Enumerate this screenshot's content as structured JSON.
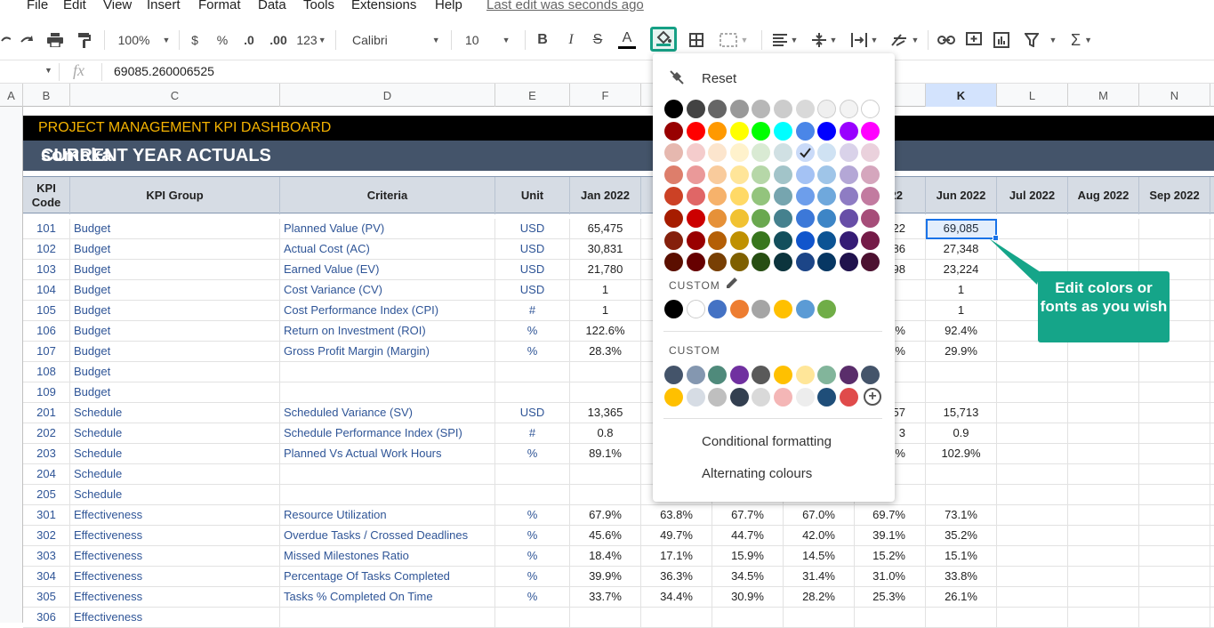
{
  "menu": {
    "items": [
      "File",
      "Edit",
      "View",
      "Insert",
      "Format",
      "Data",
      "Tools",
      "Extensions",
      "Help"
    ],
    "last_edit": "Last edit was seconds ago"
  },
  "toolbar": {
    "zoom": "100%",
    "currency": "$",
    "percent": "%",
    "dec_decrease": ".0",
    "dec_increase": ".00",
    "more_formats": "123",
    "font": "Calibri",
    "font_size": "10",
    "bold": "B",
    "italic": "I",
    "strike": "S",
    "text_color": "A",
    "sum": "Σ",
    "icons": [
      "undo-icon",
      "redo-icon",
      "print-icon",
      "paint-format-icon",
      "fill-color-icon",
      "borders-icon",
      "merge-icon",
      "align-icon",
      "valign-icon",
      "wrap-icon",
      "rotate-icon",
      "link-icon",
      "comment-icon",
      "chart-icon",
      "filter-icon",
      "functions-icon"
    ]
  },
  "formula_bar": {
    "fx": "fx",
    "value": "69085.260006525"
  },
  "columns": [
    "A",
    "B",
    "C",
    "D",
    "E",
    "F",
    "G",
    "H",
    "I",
    "J",
    "K",
    "L",
    "M",
    "N"
  ],
  "selected_column": "K",
  "sheet": {
    "title": "PROJECT MANAGEMENT KPI DASHBOARD",
    "subtitle": "CURRENT YEAR ACTUALS",
    "logo": "someka",
    "headers": {
      "code": "KPI Code",
      "group": "KPI Group",
      "criteria": "Criteria",
      "unit": "Unit",
      "months": [
        "Jan 2022",
        "",
        "",
        "",
        "2022",
        "Jun 2022",
        "Jul 2022",
        "Aug 2022",
        "Sep 2022"
      ]
    },
    "rows": [
      {
        "rn": "",
        "code": "101",
        "group": "Budget",
        "criteria": "Planned Value (PV)",
        "unit": "USD",
        "f": "65,475",
        "g": "",
        "h": "",
        "i": "",
        "j": "22",
        "k": "69,085"
      },
      {
        "rn": "",
        "code": "102",
        "group": "Budget",
        "criteria": "Actual Cost (AC)",
        "unit": "USD",
        "f": "30,831",
        "g": "",
        "h": "",
        "i": "",
        "j": "86",
        "k": "27,348"
      },
      {
        "rn": "",
        "code": "103",
        "group": "Budget",
        "criteria": "Earned Value (EV)",
        "unit": "USD",
        "f": "21,780",
        "g": "",
        "h": "",
        "i": "",
        "j": "98",
        "k": "23,224"
      },
      {
        "rn": "",
        "code": "104",
        "group": "Budget",
        "criteria": "Cost Variance (CV)",
        "unit": "USD",
        "f": "1",
        "g": "",
        "h": "",
        "i": "",
        "j": "",
        "k": "1"
      },
      {
        "rn": "",
        "code": "105",
        "group": "Budget",
        "criteria": "Cost Performance Index (CPI)",
        "unit": "#",
        "f": "1",
        "g": "",
        "h": "",
        "i": "",
        "j": "",
        "k": "1"
      },
      {
        "rn": "",
        "code": "106",
        "group": "Budget",
        "criteria": "Return on Investment (ROI)",
        "unit": "%",
        "f": "122.6%",
        "g": "",
        "h": "",
        "i": "",
        "j": "4%",
        "k": "92.4%"
      },
      {
        "rn": "",
        "code": "107",
        "group": "Budget",
        "criteria": "Gross Profit Margin (Margin)",
        "unit": "%",
        "f": "28.3%",
        "g": "",
        "h": "",
        "i": "",
        "j": "4%",
        "k": "29.9%"
      },
      {
        "rn": "",
        "code": "108",
        "group": "Budget",
        "criteria": "",
        "unit": "",
        "f": "",
        "g": "",
        "h": "",
        "i": "",
        "j": "",
        "k": ""
      },
      {
        "rn": "",
        "code": "109",
        "group": "Budget",
        "criteria": "",
        "unit": "",
        "f": "",
        "g": "",
        "h": "",
        "i": "",
        "j": "",
        "k": ""
      },
      {
        "rn": "",
        "code": "201",
        "group": "Schedule",
        "criteria": "Scheduled Variance (SV)",
        "unit": "USD",
        "f": "13,365",
        "g": "",
        "h": "",
        "i": "",
        "j": "57",
        "k": "15,713"
      },
      {
        "rn": "",
        "code": "202",
        "group": "Schedule",
        "criteria": "Schedule Performance Index (SPI)",
        "unit": "#",
        "f": "0.8",
        "g": "",
        "h": "",
        "i": "",
        "j": "3",
        "k": "0.9"
      },
      {
        "rn": "",
        "code": "203",
        "group": "Schedule",
        "criteria": "Planned Vs Actual Work Hours",
        "unit": "%",
        "f": "89.1%",
        "g": "",
        "h": "",
        "i": "",
        "j": "9%",
        "k": "102.9%"
      },
      {
        "rn": "",
        "code": "204",
        "group": "Schedule",
        "criteria": "",
        "unit": "",
        "f": "",
        "g": "",
        "h": "",
        "i": "",
        "j": "",
        "k": ""
      },
      {
        "rn": "",
        "code": "205",
        "group": "Schedule",
        "criteria": "",
        "unit": "",
        "f": "",
        "g": "",
        "h": "",
        "i": "",
        "j": "",
        "k": ""
      },
      {
        "rn": "",
        "code": "301",
        "group": "Effectiveness",
        "criteria": "Resource Utilization",
        "unit": "%",
        "f": "67.9%",
        "g": "63.8%",
        "h": "67.7%",
        "i": "67.0%",
        "j": "69.7%",
        "k": "73.1%"
      },
      {
        "rn": "",
        "code": "302",
        "group": "Effectiveness",
        "criteria": "Overdue Tasks / Crossed Deadlines",
        "unit": "%",
        "f": "45.6%",
        "g": "49.7%",
        "h": "44.7%",
        "i": "42.0%",
        "j": "39.1%",
        "k": "35.2%"
      },
      {
        "rn": "",
        "code": "303",
        "group": "Effectiveness",
        "criteria": "Missed Milestones Ratio",
        "unit": "%",
        "f": "18.4%",
        "g": "17.1%",
        "h": "15.9%",
        "i": "14.5%",
        "j": "15.2%",
        "k": "15.1%"
      },
      {
        "rn": "",
        "code": "304",
        "group": "Effectiveness",
        "criteria": "Percentage Of Tasks Completed",
        "unit": "%",
        "f": "39.9%",
        "g": "36.3%",
        "h": "34.5%",
        "i": "31.4%",
        "j": "31.0%",
        "k": "33.8%"
      },
      {
        "rn": "",
        "code": "305",
        "group": "Effectiveness",
        "criteria": "Tasks % Completed On Time",
        "unit": "%",
        "f": "33.7%",
        "g": "34.4%",
        "h": "30.9%",
        "i": "28.2%",
        "j": "25.3%",
        "k": "26.1%"
      },
      {
        "rn": "",
        "code": "306",
        "group": "Effectiveness",
        "criteria": "",
        "unit": "",
        "f": "",
        "g": "",
        "h": "",
        "i": "",
        "j": "",
        "k": ""
      }
    ]
  },
  "callout": "Edit colors or fonts as you wish",
  "palette": {
    "reset": "Reset",
    "custom1": "CUSTOM",
    "custom2": "CUSTOM",
    "conditional": "Conditional formatting",
    "alternating": "Alternating colours",
    "selected_swatch": "#c9daf8",
    "grid": [
      [
        "#000000",
        "#434343",
        "#666666",
        "#999999",
        "#b7b7b7",
        "#cccccc",
        "#d9d9d9",
        "#efefef",
        "#f3f3f3",
        "#ffffff"
      ],
      [
        "#980000",
        "#ff0000",
        "#ff9900",
        "#ffff00",
        "#00ff00",
        "#00ffff",
        "#4a86e8",
        "#0000ff",
        "#9900ff",
        "#ff00ff"
      ],
      [
        "#e6b8af",
        "#f4cccc",
        "#fce5cd",
        "#fff2cc",
        "#d9ead3",
        "#d0e0e3",
        "#c9daf8",
        "#cfe2f3",
        "#d9d2e9",
        "#ead1dc"
      ],
      [
        "#dd7e6b",
        "#ea9999",
        "#f9cb9c",
        "#ffe599",
        "#b6d7a8",
        "#a2c4c9",
        "#a4c2f4",
        "#9fc5e8",
        "#b4a7d6",
        "#d5a6bd"
      ],
      [
        "#cc4125",
        "#e06666",
        "#f6b26b",
        "#ffd966",
        "#93c47d",
        "#76a5af",
        "#6d9eeb",
        "#6fa8dc",
        "#8e7cc3",
        "#c27ba0"
      ],
      [
        "#a61c00",
        "#cc0000",
        "#e69138",
        "#f1c232",
        "#6aa84f",
        "#45818e",
        "#3c78d8",
        "#3d85c6",
        "#674ea7",
        "#a64d79"
      ],
      [
        "#85200c",
        "#990000",
        "#b45f06",
        "#bf9000",
        "#38761d",
        "#134f5c",
        "#1155cc",
        "#0b5394",
        "#351c75",
        "#741b47"
      ],
      [
        "#5b0f00",
        "#660000",
        "#783f04",
        "#7f6000",
        "#274e13",
        "#0c343d",
        "#1c4587",
        "#073763",
        "#20124d",
        "#4c1130"
      ]
    ],
    "custom_row1": [
      "#000000",
      "#ffffff",
      "#4472c4",
      "#ed7d31",
      "#a5a5a5",
      "#ffc000",
      "#5b9bd5",
      "#70ad47"
    ],
    "custom_row2": [
      "#44546a",
      "#8497b0",
      "#4f8a7b",
      "#7030a0",
      "#595959",
      "#ffc000",
      "#ffe699",
      "#82b59b",
      "#5a2d6b",
      "#44546a"
    ],
    "custom_row3": [
      "#ffc000",
      "#d6dce4",
      "#bfbfbf",
      "#333f50",
      "#d9d9d9",
      "#f4b6b6",
      "#ededed",
      "#1f4e79",
      "#e04b4b"
    ]
  },
  "colors": {
    "accent": "#16a085",
    "banner_dark": "#000000",
    "banner_title": "#f5b301",
    "banner_sub": "#44546a",
    "header_fill": "#d6dce4",
    "text_blue": "#2f5597"
  }
}
